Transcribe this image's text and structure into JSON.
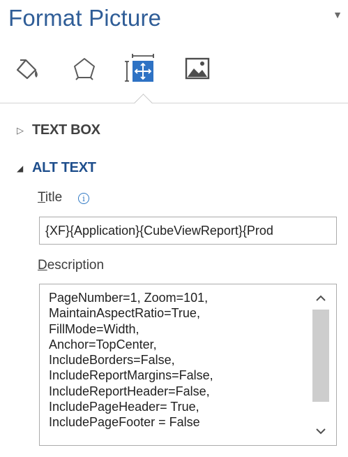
{
  "pane": {
    "title": "Format Picture",
    "dropdown_glyph": "▼"
  },
  "tabs": [
    {
      "icon": "fill-line-icon",
      "active": false
    },
    {
      "icon": "effects-pentagon-icon",
      "active": false
    },
    {
      "icon": "size-properties-icon",
      "active": true
    },
    {
      "icon": "picture-icon",
      "active": false
    }
  ],
  "sections": {
    "text_box": {
      "label": "TEXT BOX",
      "state": "collapsed",
      "glyph": "▷"
    },
    "alt_text": {
      "label": "ALT TEXT",
      "state": "expanded",
      "glyph": "◢"
    }
  },
  "alt_text": {
    "title_label_accel": "T",
    "title_label_rest": "itle",
    "info_glyph": "i",
    "title_value": "{XF}{Application}{CubeViewReport}{Prod",
    "description_label_accel": "D",
    "description_label_rest": "escription",
    "description_lines": [
      "PageNumber=1, Zoom=101,",
      "MaintainAspectRatio=True,",
      "FillMode=Width,",
      "Anchor=TopCenter,",
      "IncludeBorders=False,",
      "IncludeReportMargins=False,",
      "IncludeReportHeader=False,",
      "IncludePageHeader= True,",
      "IncludePageFooter = False"
    ],
    "scroll_up_glyph": "⌃",
    "scroll_down_glyph": "⌄"
  },
  "colors": {
    "title": "#2f5d97",
    "section_expanded": "#1e4e8c",
    "active_icon": "#2e72c4"
  }
}
